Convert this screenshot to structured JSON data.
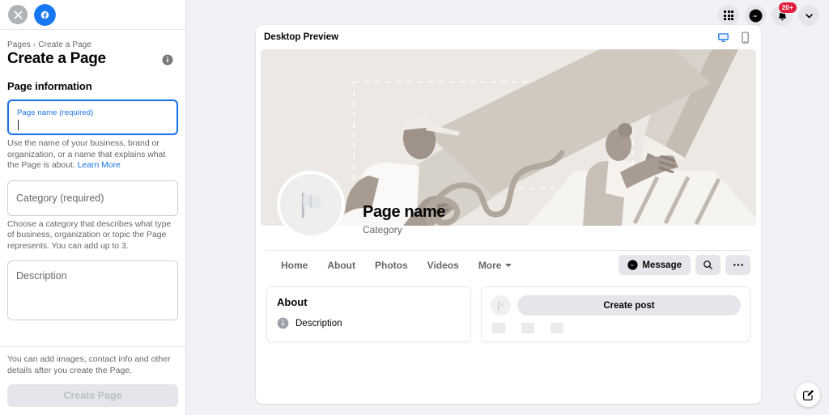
{
  "left_panel": {
    "close_label": "×",
    "logo_name": "facebook-logo",
    "breadcrumb": {
      "root": "Pages",
      "separator": "›",
      "current": "Create a Page"
    },
    "title": "Create a Page",
    "info_icon": "info-icon",
    "section_title": "Page information",
    "fields": {
      "page_name": {
        "label": "Page name (required)",
        "value": "",
        "help": "Use the name of your business, brand or organization, or a name that explains what the Page is about. ",
        "help_link": "Learn More",
        "focused": true
      },
      "category": {
        "placeholder": "Category (required)",
        "value": "",
        "help": "Choose a category that describes what type of business, organization or topic the Page represents. You can add up to 3."
      },
      "description": {
        "placeholder": "Description",
        "value": ""
      }
    },
    "footer": {
      "note": "You can add images, contact info and other details after you create the Page.",
      "submit_label": "Create Page",
      "submit_disabled": true
    }
  },
  "topnav": {
    "menu_icon": "grid-menu-icon",
    "messenger_icon": "messenger-icon",
    "notifications_icon": "bell-icon",
    "notifications_badge": "20+",
    "account_icon": "chevron-down-icon"
  },
  "preview": {
    "header_title": "Desktop Preview",
    "desktop_icon": "desktop-icon",
    "mobile_icon": "mobile-icon",
    "active_device": "desktop",
    "cover_alt": "cover-photo-illustration",
    "profile": {
      "avatar_icon": "flag-icon",
      "name": "Page name",
      "category": "Category"
    },
    "tabs": [
      {
        "label": "Home"
      },
      {
        "label": "About"
      },
      {
        "label": "Photos"
      },
      {
        "label": "Videos"
      },
      {
        "label": "More",
        "has_caret": true
      }
    ],
    "actions": {
      "message_label": "Message",
      "message_icon": "messenger-icon",
      "search_icon": "search-icon",
      "more_icon": "ellipsis-icon"
    },
    "about_card": {
      "title": "About",
      "row_icon": "info-icon",
      "row_label": "Description"
    },
    "post_card": {
      "avatar_icon": "flag-icon",
      "create_post_label": "Create post"
    }
  },
  "fab": {
    "icon": "compose-icon"
  },
  "colors": {
    "brand_blue": "#1877f2",
    "focus_blue": "#1b74e4",
    "link_blue": "#1b74e4",
    "badge_red": "#e41e3f",
    "page_bg": "#f0f2f5",
    "cover_bg": "#ece9e4",
    "button_gray": "#e4e6eb",
    "text_primary": "#050505",
    "text_secondary": "#65676b"
  }
}
